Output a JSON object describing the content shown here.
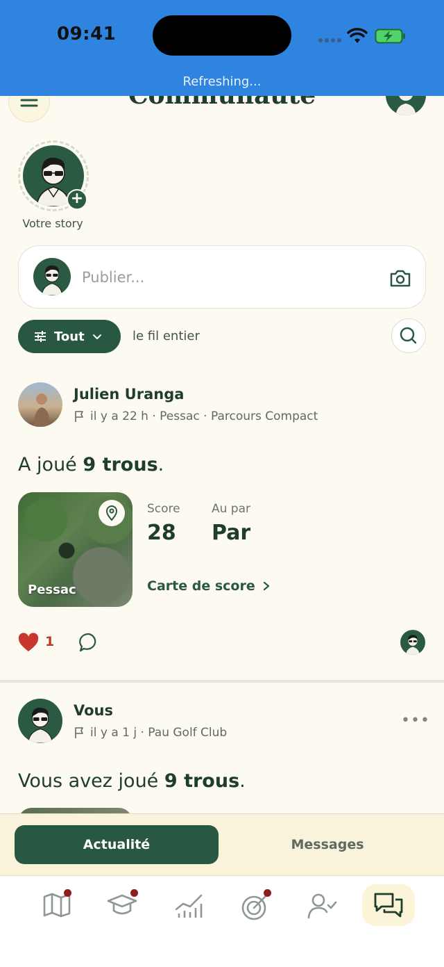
{
  "status_bar": {
    "time": "09:41",
    "refreshing": "Refreshing..."
  },
  "header": {
    "title": "Communauté"
  },
  "story": {
    "label": "Votre story",
    "add": "+"
  },
  "composer": {
    "placeholder": "Publier..."
  },
  "filter": {
    "chip_label": "Tout",
    "description": "le fil entier"
  },
  "posts": [
    {
      "author": "Julien Uranga",
      "meta": "il y a 22 h · Pessac · Parcours Compact",
      "summary_prefix": "A joué",
      "summary_bold": "9 trous",
      "summary_suffix": ".",
      "map_label": "Pessac",
      "score_label": "Score",
      "score_value": "28",
      "par_label": "Au par",
      "par_value": "Par",
      "card_link": "Carte de score",
      "likes": "1"
    },
    {
      "author": "Vous",
      "meta": "il y a 1 j · Pau Golf Club",
      "summary_prefix": "Vous avez joué",
      "summary_bold": "9 trous",
      "summary_suffix": ".",
      "more": "•••"
    }
  ],
  "segments": {
    "active": "Actualité",
    "inactive": "Messages"
  },
  "bottom_nav": [
    {
      "icon": "map-icon",
      "badge": true
    },
    {
      "icon": "graduation-cap-icon",
      "badge": true
    },
    {
      "icon": "stats-chart-icon",
      "badge": false
    },
    {
      "icon": "target-icon",
      "badge": true
    },
    {
      "icon": "user-check-icon",
      "badge": false
    },
    {
      "icon": "chat-bubbles-icon",
      "badge": false,
      "active": true
    }
  ],
  "colors": {
    "status_bar": "#2F84E0",
    "primary": "#285841",
    "background": "#FDFBF1",
    "like": "#C8372D",
    "badge": "#8E1E1E"
  }
}
